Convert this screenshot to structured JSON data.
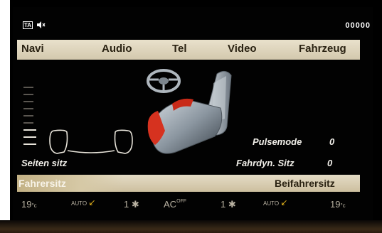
{
  "status": {
    "ta_label": "TA",
    "icon_mute": "speaker-mute-icon",
    "right_text": "00000"
  },
  "menu": {
    "items": [
      {
        "label": "Navi"
      },
      {
        "label": "Audio"
      },
      {
        "label": "Tel"
      },
      {
        "label": "Video"
      },
      {
        "label": "Fahrzeug"
      }
    ]
  },
  "seat_settings": {
    "side_label": "Seiten sitz",
    "pulse_label": "Pulsemode",
    "pulse_value": "0",
    "dynamic_label": "Fahrdyn. Sitz",
    "dynamic_value": "0",
    "side_level_steps": 9,
    "side_level_active": 3
  },
  "seat_tabs": {
    "driver_label": "Fahrersitz",
    "passenger_label": "Beifahrersitz",
    "selected": "driver"
  },
  "climate": {
    "left_temp": "19",
    "left_temp_unit": "°c",
    "left_auto": "AUTO",
    "left_fan": "1",
    "ac_label": "AC",
    "ac_sup": "OFF",
    "right_fan": "1",
    "right_auto": "AUTO",
    "right_temp": "19",
    "right_temp_unit": "°c"
  },
  "colors": {
    "menu_bar": "#ddd3ba",
    "accent_red": "#d6321f"
  }
}
